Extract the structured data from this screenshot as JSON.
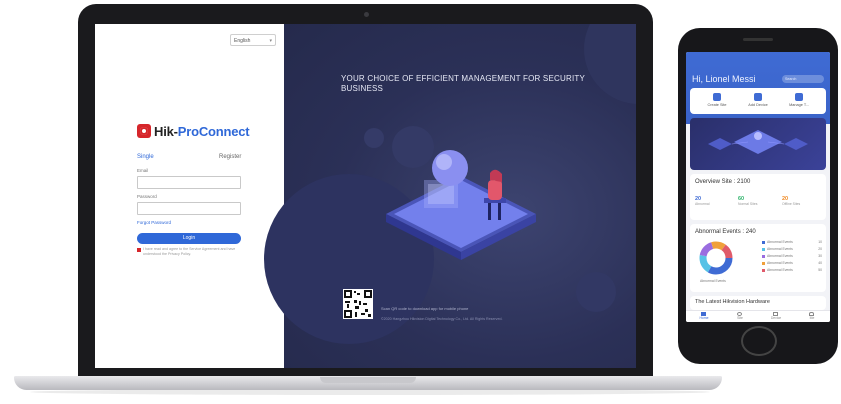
{
  "login": {
    "language": "English",
    "brand_prefix": "Hik-",
    "brand_suffix": "ProConnect",
    "tab_single": "Single",
    "tab_register": "Register",
    "field1_label": "Email",
    "field2_label": "Password",
    "forgot": "Forgot Password",
    "login_button": "Login",
    "agreement": "I have read and agree to the Service Agreement and have understood the Privacy Policy."
  },
  "promo": {
    "headline": "YOUR CHOICE OF EFFICIENT MANAGEMENT FOR SECURITY BUSINESS",
    "qr_caption": "Scan QR code to download app for mobile phone",
    "copyright": "©2020 Hangzhou Hikvision Digital Technology Co., Ltd. All Rights Reserved."
  },
  "phone": {
    "greeting": "Hi, Lionel Messi",
    "search_placeholder": "Search",
    "quick_actions": [
      "Create Site",
      "Add Device",
      "Manage T..."
    ],
    "overview_title": "Overview Site : 2100",
    "stats": [
      {
        "value": "20",
        "label": "Abnormal",
        "color": "#3f6bd4"
      },
      {
        "value": "60",
        "label": "Normal Sites",
        "color": "#2db36a"
      },
      {
        "value": "20",
        "label": "Offline Sites",
        "color": "#f08a24"
      }
    ],
    "abnormal_title": "Abnormal Events : 240",
    "donut_caption": "Abnormal Events",
    "legend": [
      {
        "label": "Abnormal Events",
        "value": "10",
        "color": "#3f6bd4"
      },
      {
        "label": "Abnormal Events",
        "value": "20",
        "color": "#56c2e6"
      },
      {
        "label": "Abnormal Events",
        "value": "30",
        "color": "#9a6de0"
      },
      {
        "label": "Abnormal Events",
        "value": "40",
        "color": "#f0a03b"
      },
      {
        "label": "Abnormal Events",
        "value": "50",
        "color": "#e05a6a"
      }
    ],
    "next_section": "The Latest Hikvision Hardware",
    "nav": [
      "Home",
      "Site",
      "Device",
      "Me"
    ]
  }
}
